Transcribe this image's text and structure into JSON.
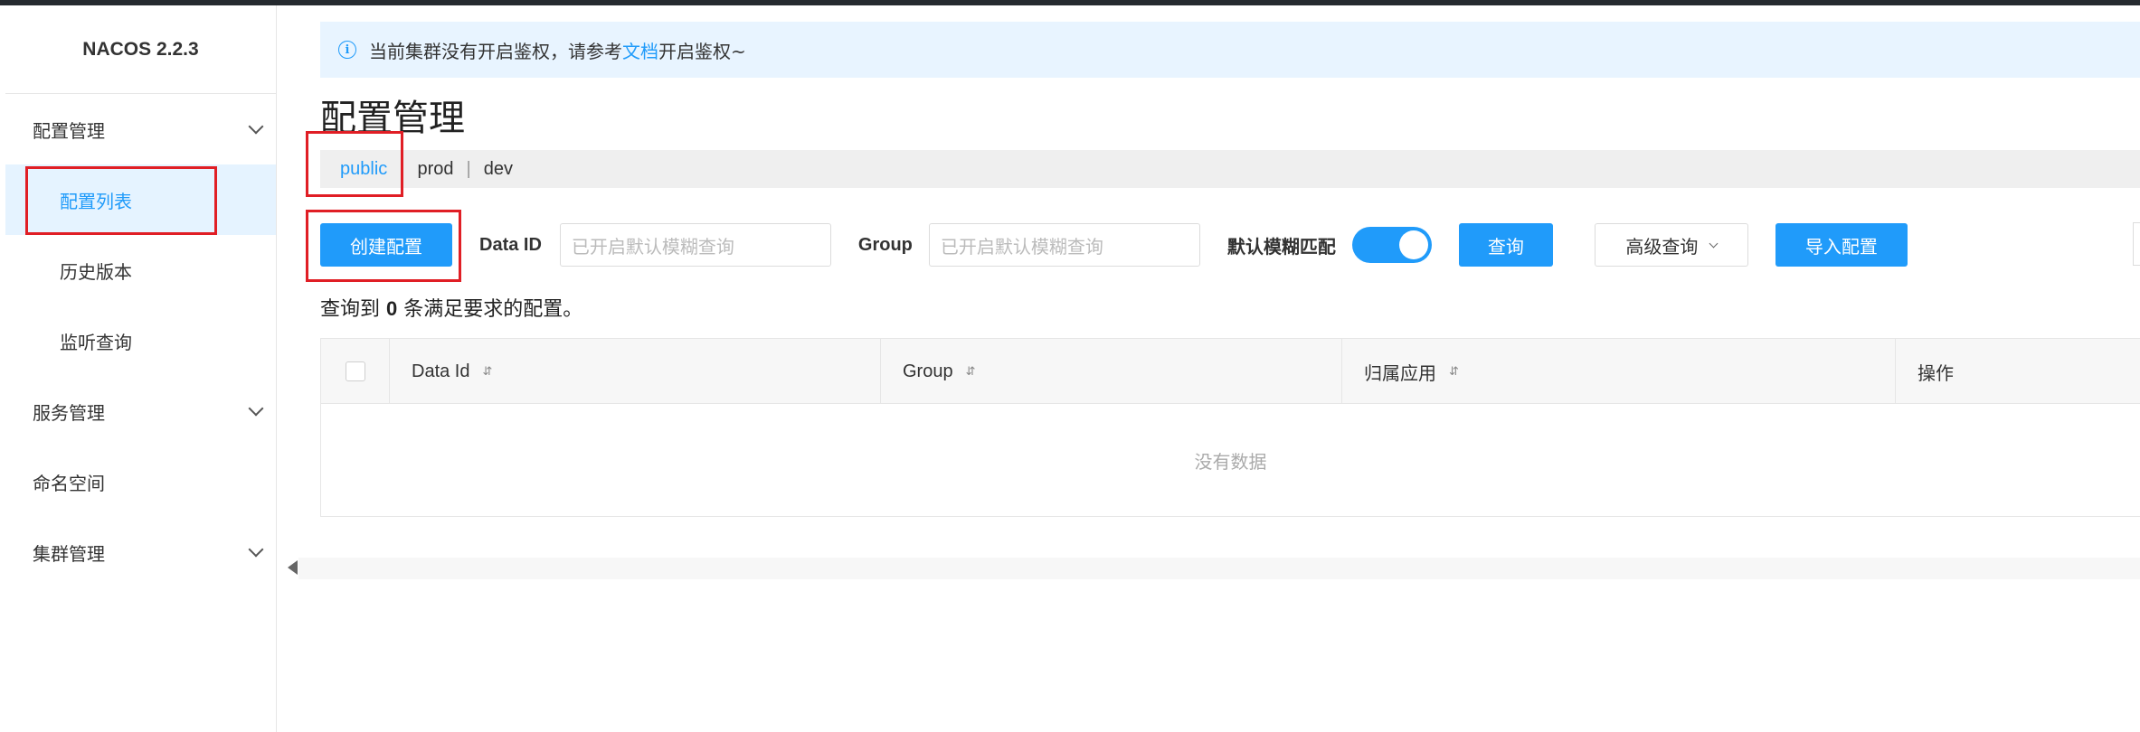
{
  "app": {
    "logo": "NACOS 2.2.3"
  },
  "sidebar": {
    "groups": [
      {
        "label": "配置管理",
        "items": [
          "配置列表",
          "历史版本",
          "监听查询"
        ]
      },
      {
        "label": "服务管理"
      },
      {
        "label": "命名空间"
      },
      {
        "label": "集群管理"
      }
    ],
    "active_item": "配置列表"
  },
  "notice": {
    "text_before": "当前集群没有开启鉴权，请参考",
    "link": "文档",
    "text_after": "开启鉴权~"
  },
  "page": {
    "title": "配置管理"
  },
  "namespaces": [
    "public",
    "prod",
    "dev"
  ],
  "namespace_separator": "|",
  "filters": {
    "create_button": "创建配置",
    "data_id_label": "Data ID",
    "data_id_placeholder": "已开启默认模糊查询",
    "group_label": "Group",
    "group_placeholder": "已开启默认模糊查询",
    "fuzzy_label": "默认模糊匹配",
    "fuzzy_enabled": true,
    "query_button": "查询",
    "advanced_button": "高级查询",
    "import_button": "导入配置"
  },
  "result": {
    "prefix": "查询到",
    "count": "0",
    "suffix": "条满足要求的配置。"
  },
  "table": {
    "columns": [
      "Data Id",
      "Group",
      "归属应用",
      "操作"
    ],
    "sort_glyph": "⇵",
    "empty_text": "没有数据"
  },
  "colors": {
    "primary": "#209bfa",
    "highlight": "#e01e25",
    "notice_bg": "#e8f4ff"
  }
}
